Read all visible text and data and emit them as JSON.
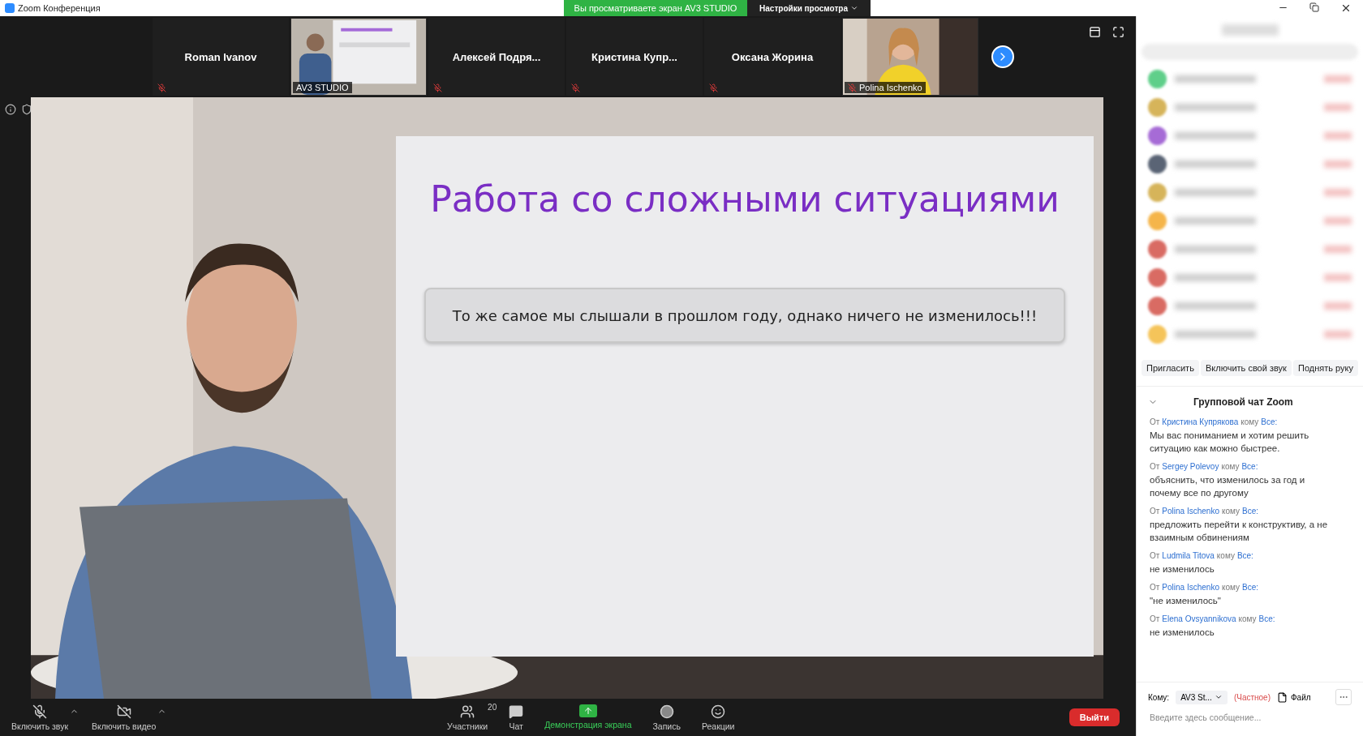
{
  "window": {
    "title": "Zoom Конференция"
  },
  "share_banner": {
    "text": "Вы просматриваете экран AV3 STUDIO",
    "menu": "Настройки просмотра"
  },
  "tiles": [
    {
      "name": "Roman Ivanov",
      "kind": "name",
      "muted": true
    },
    {
      "name": "AV3 STUDIO",
      "kind": "video",
      "muted": false
    },
    {
      "name": "Алексей  Подря...",
      "kind": "name",
      "muted": true
    },
    {
      "name": "Кристина  Купр...",
      "kind": "name",
      "muted": true
    },
    {
      "name": "Оксана Жорина",
      "kind": "name",
      "muted": true
    },
    {
      "name": "Polina Ischenko",
      "kind": "video",
      "muted": true
    }
  ],
  "slide": {
    "title": "Работа со сложными ситуациями",
    "quote": "То же самое мы слышали в прошлом году, однако ничего не изменилось!!!"
  },
  "toolbar": {
    "left": [
      {
        "label": "Включить звук",
        "kind": "mic"
      },
      {
        "label": "Включить видео",
        "kind": "video"
      }
    ],
    "center": [
      {
        "label": "Участники",
        "kind": "participants",
        "count": "20"
      },
      {
        "label": "Чат",
        "kind": "chat"
      },
      {
        "label": "Демонстрация экрана",
        "kind": "share"
      },
      {
        "label": "Запись",
        "kind": "record"
      },
      {
        "label": "Реакции",
        "kind": "reactions"
      }
    ],
    "leave": "Выйти"
  },
  "participants": {
    "rows": [
      {
        "color": "#5fcf8a"
      },
      {
        "color": "#d6b45a"
      },
      {
        "color": "#a66bd6"
      },
      {
        "color": "#5a6475"
      },
      {
        "color": "#d6b45a"
      },
      {
        "color": "#f5b54a"
      },
      {
        "color": "#d96b63"
      },
      {
        "color": "#d96b63"
      },
      {
        "color": "#d96b63"
      },
      {
        "color": "#f5c45a"
      }
    ]
  },
  "panel_buttons": [
    "Пригласить",
    "Включить свой звук",
    "Поднять руку"
  ],
  "chat": {
    "title": "Групповой чат Zoom",
    "messages": [
      {
        "from_label": "От",
        "sender": "Кристина Купрякова",
        "to_label": "кому",
        "recipient": "Все:",
        "text": "Мы вас пониманием и хотим решить ситуацию как можно быстрее."
      },
      {
        "from_label": "От",
        "sender": "Sergey Polevoy",
        "to_label": "кому",
        "recipient": "Все:",
        "text": "объяснить, что изменилось за год и почему все по другому"
      },
      {
        "from_label": "От",
        "sender": "Polina Ischenko",
        "to_label": "кому",
        "recipient": "Все:",
        "text": "предложить перейти к конструктиву, а не взаимным обвинениям"
      },
      {
        "from_label": "От",
        "sender": "Ludmila Titova",
        "to_label": "кому",
        "recipient": "Все:",
        "text": "не изменилось"
      },
      {
        "from_label": "От",
        "sender": "Polina Ischenko",
        "to_label": "кому",
        "recipient": "Все:",
        "text": "\"не изменилось\""
      },
      {
        "from_label": "От",
        "sender": "Elena Ovsyannikova",
        "to_label": "кому",
        "recipient": "Все:",
        "text": "не изменилось"
      }
    ],
    "to_label": "Кому:",
    "recipient": "AV3 St...",
    "private": "(Частное)",
    "file": "Файл",
    "placeholder": "Введите здесь сообщение..."
  }
}
